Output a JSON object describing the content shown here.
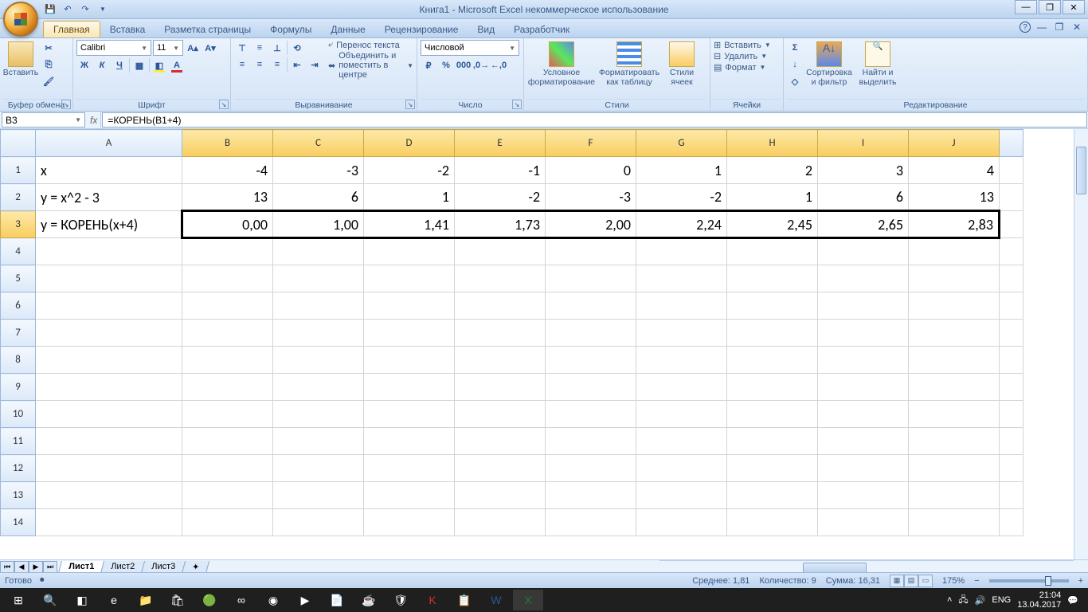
{
  "title": "Книга1 - Microsoft Excel некоммерческое использование",
  "qat": {
    "save_title": "Сохранить",
    "undo_title": "Отменить",
    "redo_title": "Повторить"
  },
  "tabs": {
    "home": "Главная",
    "insert": "Вставка",
    "page_layout": "Разметка страницы",
    "formulas": "Формулы",
    "data": "Данные",
    "review": "Рецензирование",
    "view": "Вид",
    "developer": "Разработчик"
  },
  "ribbon": {
    "clipboard": {
      "paste": "Вставить",
      "label": "Буфер обмена"
    },
    "font": {
      "name": "Calibri",
      "size": "11",
      "label": "Шрифт",
      "bold": "Ж",
      "italic": "К",
      "underline": "Ч"
    },
    "alignment": {
      "wrap": "Перенос текста",
      "merge": "Объединить и поместить в центре",
      "label": "Выравнивание"
    },
    "number": {
      "format": "Числовой",
      "label": "Число"
    },
    "styles": {
      "conditional": "Условное форматирование",
      "as_table": "Форматировать как таблицу",
      "cell_styles": "Стили ячеек",
      "label": "Стили"
    },
    "cells": {
      "insert": "Вставить",
      "delete": "Удалить",
      "format": "Формат",
      "label": "Ячейки"
    },
    "editing": {
      "sort": "Сортировка и фильтр",
      "find": "Найти и выделить",
      "label": "Редактирование"
    }
  },
  "namebox": "B3",
  "formula": "=КОРЕНЬ(B1+4)",
  "columns": [
    "A",
    "B",
    "C",
    "D",
    "E",
    "F",
    "G",
    "H",
    "I",
    "J"
  ],
  "col_widths": {
    "A": 184,
    "other": 114
  },
  "rows_visible": 14,
  "data_rows": [
    {
      "label": "x",
      "vals": [
        "-4",
        "-3",
        "-2",
        "-1",
        "0",
        "1",
        "2",
        "3",
        "4"
      ]
    },
    {
      "label": "y = x^2 - 3",
      "vals": [
        "13",
        "6",
        "1",
        "-2",
        "-3",
        "-2",
        "1",
        "6",
        "13"
      ]
    },
    {
      "label": "y = КОРЕНЬ(x+4)",
      "vals": [
        "0,00",
        "1,00",
        "1,41",
        "1,73",
        "2,00",
        "2,24",
        "2,45",
        "2,65",
        "2,83"
      ]
    }
  ],
  "selection": {
    "row": 3,
    "cols": "B:J"
  },
  "sheets": [
    "Лист1",
    "Лист2",
    "Лист3"
  ],
  "active_sheet": 0,
  "status": {
    "ready": "Готово",
    "avg_label": "Среднее:",
    "avg": "1,81",
    "count_label": "Количество:",
    "count": "9",
    "sum_label": "Сумма:",
    "sum": "16,31",
    "zoom": "175%"
  },
  "tray": {
    "lang": "ENG",
    "time": "21:04",
    "date": "13.04.2017"
  }
}
